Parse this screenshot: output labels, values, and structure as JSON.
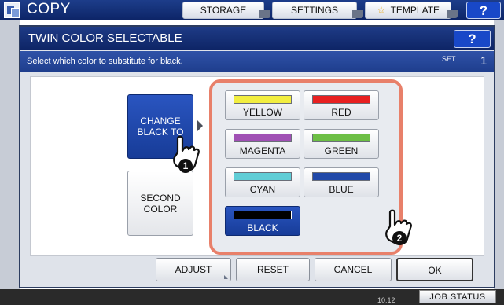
{
  "app": {
    "title": "COPY",
    "tabs": [
      {
        "label": "STORAGE"
      },
      {
        "label": "SETTINGS"
      },
      {
        "label": "TEMPLATE"
      }
    ],
    "help_label": "?"
  },
  "dialog": {
    "title": "TWIN COLOR SELECTABLE",
    "help_label": "?",
    "instruction": "Select which color to substitute for black.",
    "set_label": "SET",
    "set_count": "1",
    "mode_buttons": [
      {
        "line1": "CHANGE",
        "line2": "BLACK TO",
        "selected": true
      },
      {
        "line1": "SECOND",
        "line2": "COLOR",
        "selected": false
      }
    ],
    "colors": [
      {
        "label": "YELLOW",
        "swatch": "#f2ee40"
      },
      {
        "label": "RED",
        "swatch": "#e82020"
      },
      {
        "label": "MAGENTA",
        "swatch": "#a050b4"
      },
      {
        "label": "GREEN",
        "swatch": "#6cbe44"
      },
      {
        "label": "CYAN",
        "swatch": "#60cdd6"
      },
      {
        "label": "BLUE",
        "swatch": "#2048a8"
      },
      {
        "label": "BLACK",
        "swatch": "#000000",
        "selected": true
      }
    ],
    "actions": [
      {
        "label": "ADJUST"
      },
      {
        "label": "RESET"
      },
      {
        "label": "CANCEL"
      },
      {
        "label": "OK"
      }
    ],
    "step_markers": [
      "1",
      "2"
    ]
  },
  "status_bar": {
    "job_status_label": "JOB STATUS",
    "clock": "10:12"
  },
  "colors": {
    "title_bar": "#0e2566",
    "instruction_bar": "#1e3d8c",
    "selected_button": "#1e47ac",
    "highlight_border": "#e8806a"
  }
}
